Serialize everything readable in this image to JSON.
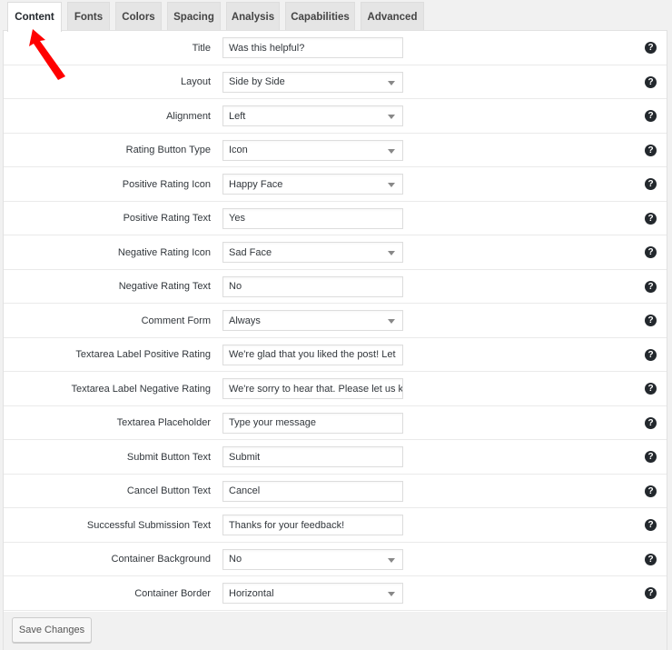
{
  "tabs": [
    {
      "label": "Content",
      "active": true
    },
    {
      "label": "Fonts"
    },
    {
      "label": "Colors"
    },
    {
      "label": "Spacing"
    },
    {
      "label": "Analysis"
    },
    {
      "label": "Capabilities"
    },
    {
      "label": "Advanced"
    }
  ],
  "help_icon_glyph": "?",
  "rows": [
    {
      "label": "Title",
      "type": "text",
      "value": "Was this helpful?"
    },
    {
      "label": "Layout",
      "type": "select",
      "value": "Side by Side"
    },
    {
      "label": "Alignment",
      "type": "select",
      "value": "Left"
    },
    {
      "label": "Rating Button Type",
      "type": "select",
      "value": "Icon"
    },
    {
      "label": "Positive Rating Icon",
      "type": "select",
      "value": "Happy Face"
    },
    {
      "label": "Positive Rating Text",
      "type": "text",
      "value": "Yes"
    },
    {
      "label": "Negative Rating Icon",
      "type": "select",
      "value": "Sad Face"
    },
    {
      "label": "Negative Rating Text",
      "type": "text",
      "value": "No"
    },
    {
      "label": "Comment Form",
      "type": "select",
      "value": "Always"
    },
    {
      "label": "Textarea Label Positive Rating",
      "type": "text",
      "value": "We're glad that you liked the post! Let"
    },
    {
      "label": "Textarea Label Negative Rating",
      "type": "text",
      "value": "We're sorry to hear that. Please let us k"
    },
    {
      "label": "Textarea Placeholder",
      "type": "text",
      "value": "Type your message"
    },
    {
      "label": "Submit Button Text",
      "type": "text",
      "value": "Submit"
    },
    {
      "label": "Cancel Button Text",
      "type": "text",
      "value": "Cancel"
    },
    {
      "label": "Successful Submission Text",
      "type": "text",
      "value": "Thanks for your feedback!"
    },
    {
      "label": "Container Background",
      "type": "select",
      "value": "No"
    },
    {
      "label": "Container Border",
      "type": "select",
      "value": "Horizontal"
    }
  ],
  "footer": {
    "save_label": "Save Changes"
  },
  "annotation": {
    "arrow_color": "#ff0000",
    "points_to": "Content"
  }
}
